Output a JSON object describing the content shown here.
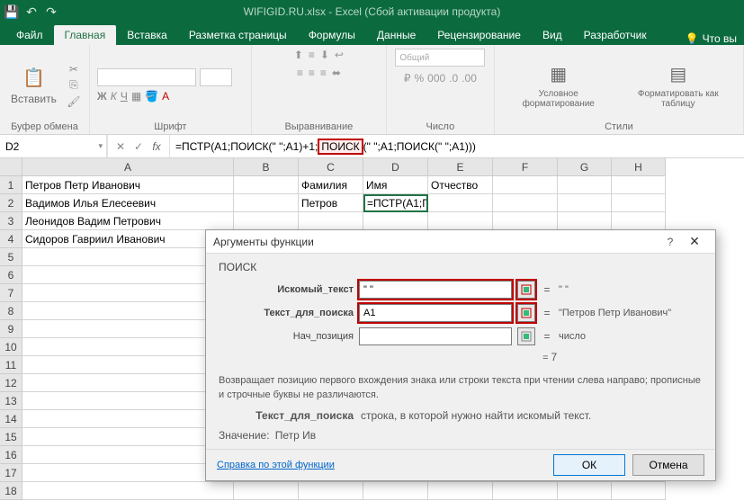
{
  "titlebar": {
    "title": "WIFIGID.RU.xlsx - Excel (Сбой активации продукта)"
  },
  "tabs": {
    "file": "Файл",
    "items": [
      "Главная",
      "Вставка",
      "Разметка страницы",
      "Формулы",
      "Данные",
      "Рецензирование",
      "Вид",
      "Разработчик"
    ],
    "tell": "Что вы"
  },
  "ribbon": {
    "clipboard": {
      "paste": "Вставить",
      "label": "Буфер обмена"
    },
    "font": {
      "label": "Шрифт",
      "bold": "Ж",
      "italic": "К",
      "underline": "Ч"
    },
    "align": {
      "label": "Выравнивание"
    },
    "number": {
      "format": "Общий",
      "label": "Число"
    },
    "styles": {
      "cond": "Условное форматирование",
      "table": "Форматировать как таблицу",
      "label": "Стили"
    }
  },
  "namebox": "D2",
  "formula": {
    "pre": "=ПСТР(A1;ПОИСК(\" \";A1)+1;",
    "highlight": "ПОИСК",
    "post": "(\" \";A1;ПОИСК(\" \";A1)))"
  },
  "columns": [
    "A",
    "B",
    "C",
    "D",
    "E",
    "F",
    "G",
    "H"
  ],
  "rows": [
    1,
    2,
    3,
    4,
    5,
    6,
    7,
    8,
    9,
    10,
    11,
    12,
    13,
    14,
    15,
    16,
    17,
    18
  ],
  "cells": {
    "A1": "Петров Петр Иванович",
    "A2": "Вадимов Илья Елесеевич",
    "A3": "Леонидов Вадим Петрович",
    "A4": "Сидоров Гавриил Иванович",
    "C1": "Фамилия",
    "D1": "Имя",
    "E1": "Отчество",
    "C2": "Петров",
    "D2": "=ПСТР(A1;ПОИСК(\" \";A1)+1;ПОИСК(\" \";A1;ПОИСК(\" \";A1)))"
  },
  "dialog": {
    "title": "Аргументы функции",
    "fn": "ПОИСК",
    "args": {
      "a1": {
        "label": "Искомый_текст",
        "value": "\" \"",
        "result": "\" \""
      },
      "a2": {
        "label": "Текст_для_поиска",
        "value": "A1",
        "result": "\"Петров Петр Иванович\""
      },
      "a3": {
        "label": "Нач_позиция",
        "value": "",
        "result": "число"
      }
    },
    "eqres": "7",
    "desc": "Возвращает позицию первого вхождения знака или строки текста при чтении слева направо; прописные и строчные буквы не различаются.",
    "argdesc_name": "Текст_для_поиска",
    "argdesc_text": "строка, в которой нужно найти искомый текст.",
    "value_label": "Значение:",
    "value": "Петр Ив",
    "help": "Справка по этой функции",
    "ok": "ОК",
    "cancel": "Отмена"
  }
}
